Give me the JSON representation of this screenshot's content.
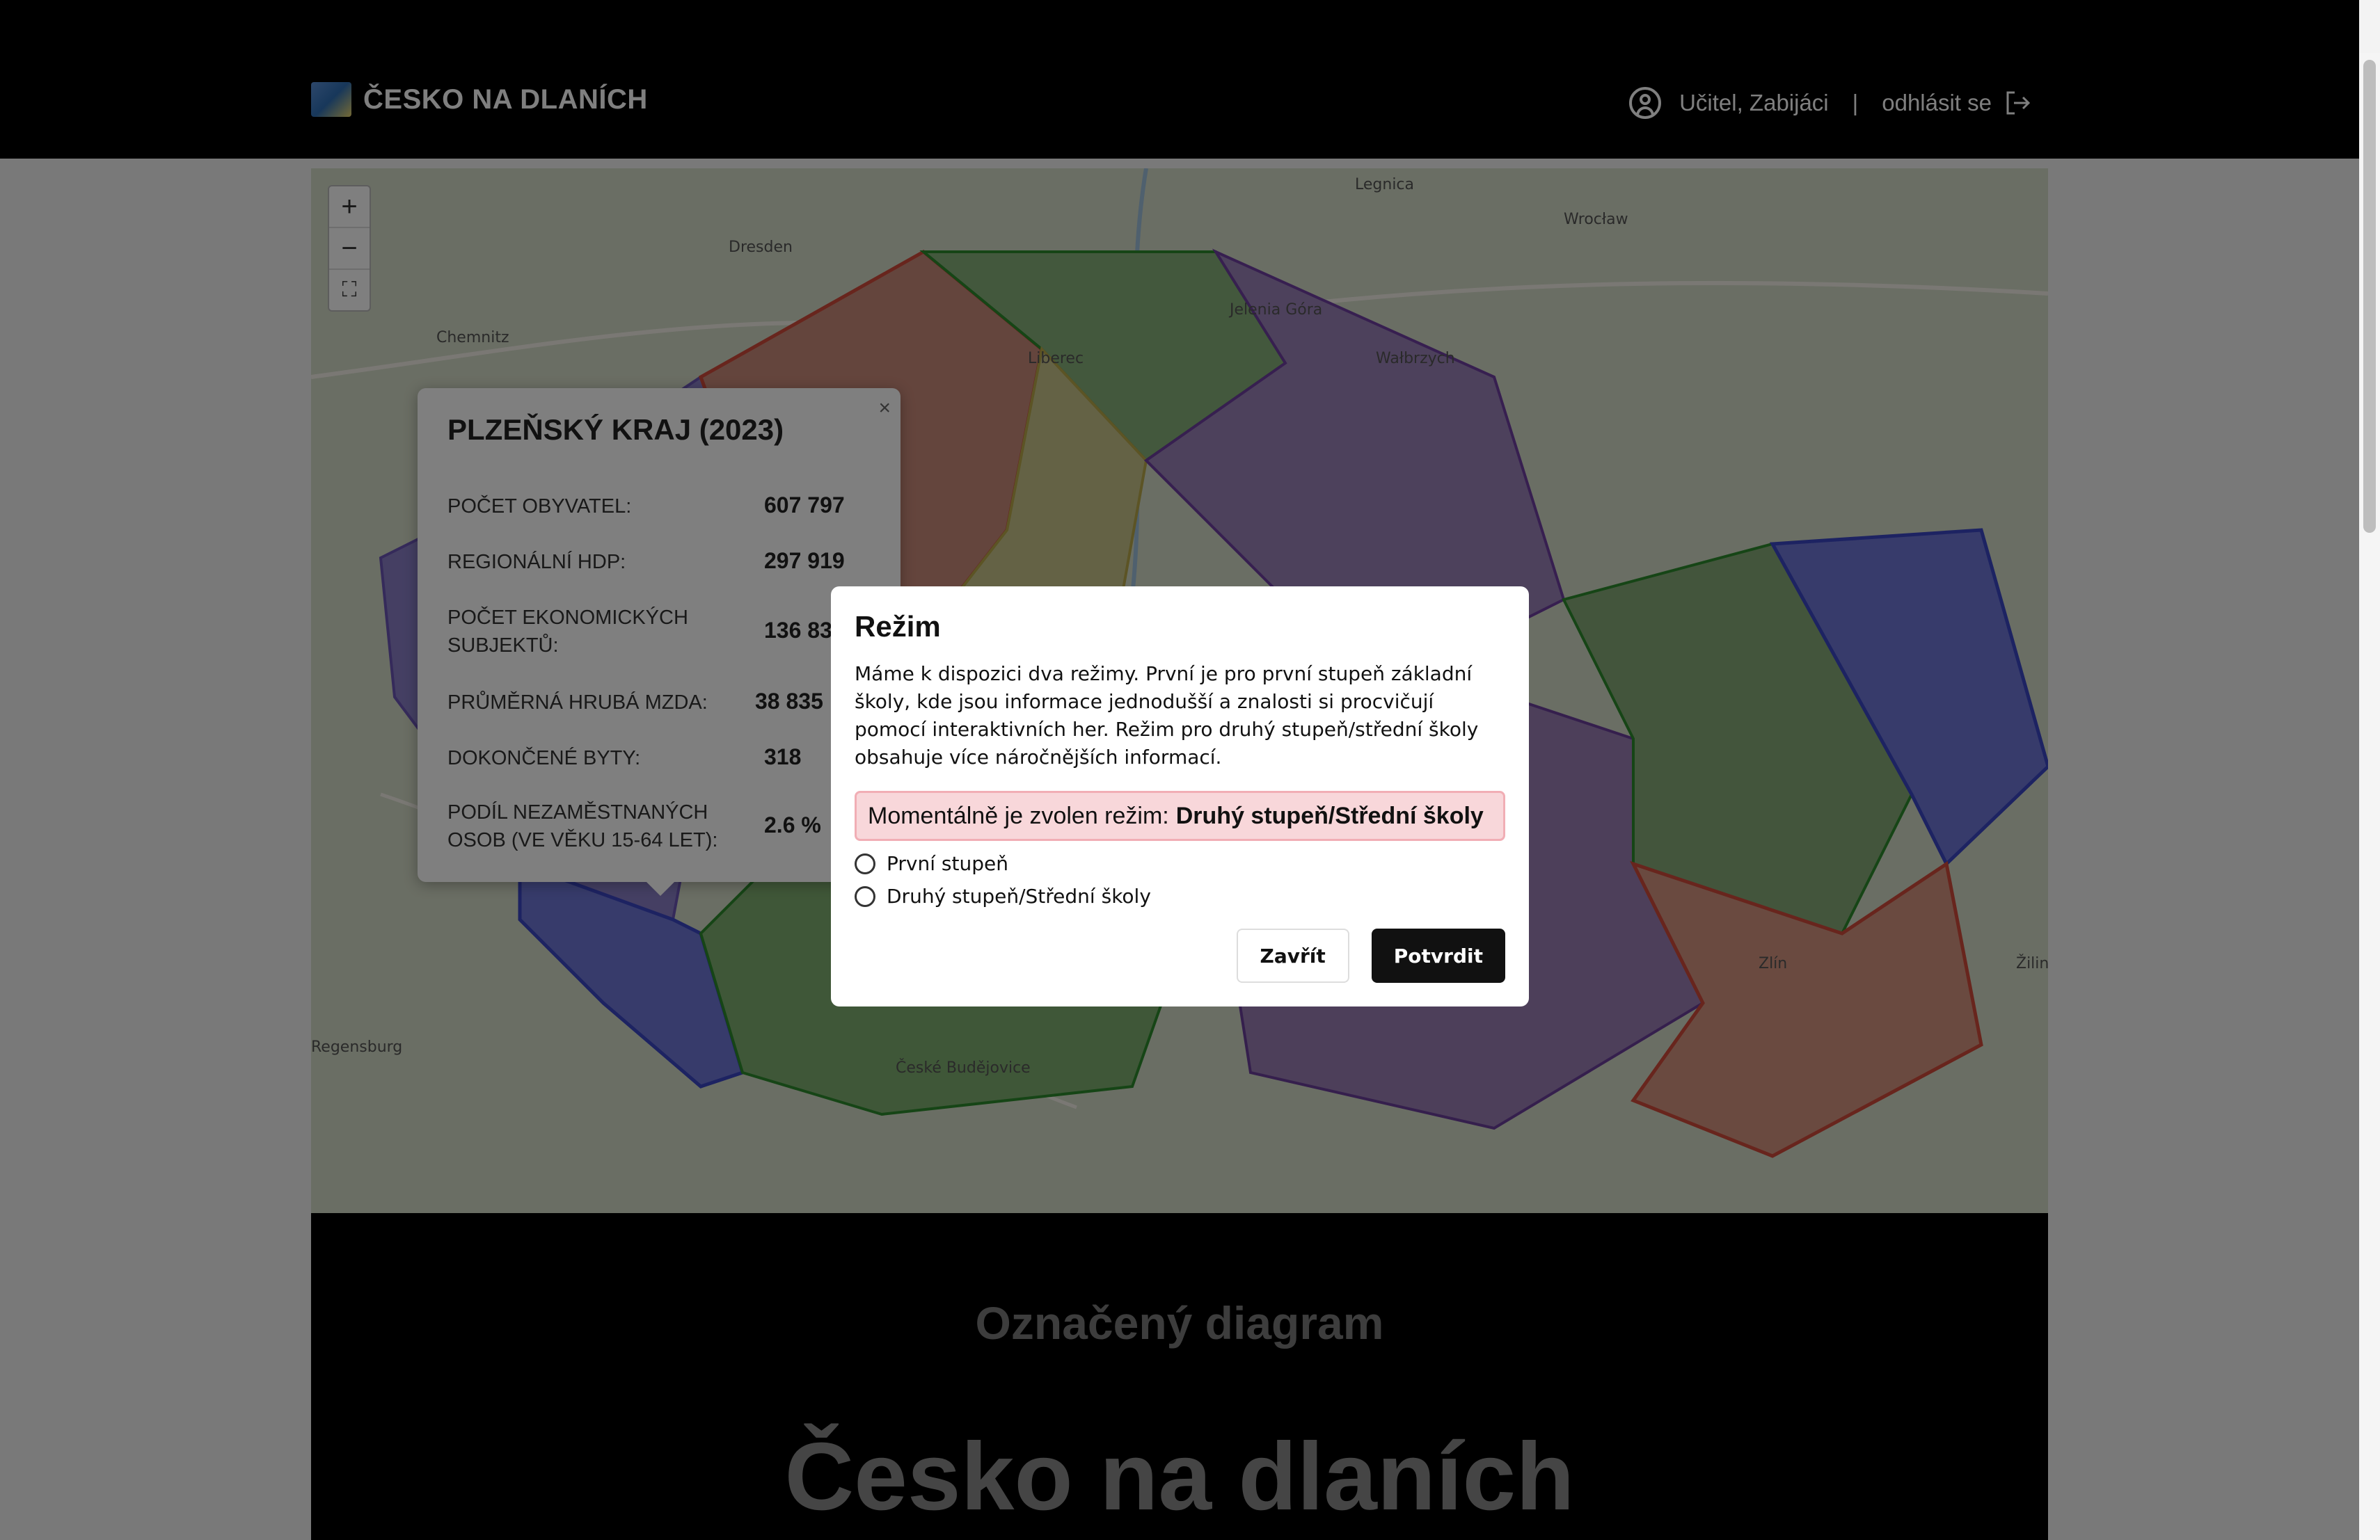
{
  "header": {
    "brand": "ČESKO NA DLANÍCH",
    "user": "Učitel, Zabijáci",
    "separator": "|",
    "logout": "odhlásit se"
  },
  "map": {
    "controls": {
      "zoom_in": "+",
      "zoom_out": "−",
      "fullscreen": "⛶"
    },
    "labels": [
      "Dresden",
      "Legnica",
      "Wrocław",
      "Chemnitz",
      "Jelenia Góra",
      "Wałbrzych",
      "Liberec",
      "Regensburg",
      "České Budějovice",
      "Zlín",
      "Žilina"
    ],
    "popup": {
      "title": "PLZEŇSKÝ KRAJ (2023)",
      "close": "×",
      "rows": [
        {
          "label": "POČET OBYVATEL:",
          "value": "607 797"
        },
        {
          "label": "REGIONÁLNÍ HDP:",
          "value": "297 919"
        },
        {
          "label": "POČET EKONOMICKÝCH SUBJEKTŮ:",
          "value": "136 83"
        },
        {
          "label": "PRŮMĚRNÁ HRUBÁ MZDA:",
          "value": "38 835"
        },
        {
          "label": "DOKONČENÉ BYTY:",
          "value": "318"
        },
        {
          "label": "PODÍL NEZAMĚSTNANÝCH OSOB (VE VĚKU 15-64 LET):",
          "value": "2.6 %"
        }
      ]
    }
  },
  "lower": {
    "subtitle": "Označený diagram",
    "title": "Česko na dlaních"
  },
  "modal": {
    "title": "Režim",
    "text": "Máme k dispozici dva režimy. První je pro první stupeň základní školy, kde jsou informace jednodušší a znalosti si procvičují pomocí interaktivních her. Režim pro druhý stupeň/střední školy obsahuje více náročnějších informací.",
    "current_prefix": "Momentálně je zvolen režim:",
    "current_value": "Druhý stupeň/Střední školy",
    "options": [
      "První stupeň",
      "Druhý stupeň/Střední školy"
    ],
    "close_label": "Zavřít",
    "confirm_label": "Potvrdit"
  },
  "colors": {
    "header_bg": "#000000",
    "modal_alert_bg": "#f8d7da",
    "confirm_bg": "#111111"
  }
}
